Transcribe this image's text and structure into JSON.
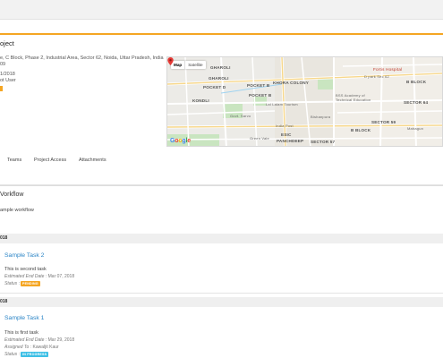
{
  "project": {
    "title": "oject",
    "address": "e, C Block, Phase 2, Industrial Area, Sector 62, Noida, Uttar Pradesh, India",
    "zip": "09",
    "date": "1/2018",
    "user": "ot User",
    "status_color": "#f5a623"
  },
  "map": {
    "type_map": "Map",
    "type_satellite": "Satellite",
    "logo": "Google",
    "labels": {
      "gharoli": "GHAROLI",
      "gharoli2": "GHAROLI",
      "pocket_d": "POCKET D",
      "pocket_b": "POCKET B",
      "khora": "KHORA COLONY",
      "kondli": "KONDLI",
      "pocket_b2": "POCKET B",
      "b_block": "B BLOCK",
      "b_block2": "B BLOCK",
      "bishanpura": "Bishanpura",
      "sector59": "SECTOR 59",
      "sector64": "SECTOR 64",
      "sector57": "SECTOR 57",
      "esic": "ESIC",
      "panchdeep": "PANCHDEEP",
      "govt_school": "Govt. Sarvo",
      "fortis": "Fortis Hospital",
      "d_park": "D park Sec 62",
      "academy": "BSS Academy of",
      "technical": "Technical Education",
      "lal_tourism": "Lal Lalam Tourism",
      "mahagun": "Mahagun",
      "india_post": "India Post",
      "green_valley": "Green Vale"
    }
  },
  "tabs": [
    "Teams",
    "Project Access",
    "Attachments"
  ],
  "workflow": {
    "title": "Vorkflow",
    "description": "ample workflow"
  },
  "tasks": [
    {
      "date_header": "018",
      "title": "Sample Task 2",
      "description": "This is second task",
      "end_label": "Estimated End Date",
      "end_date": "Mar 07, 2018",
      "status_label": "Status",
      "status_badge": "PENDING",
      "badge_color": "#f5a623"
    },
    {
      "date_header": "018",
      "title": "Sample Task 1",
      "description": "This is first task",
      "end_label": "Estimated End Date",
      "end_date": "Mar 29, 2018",
      "assigned_label": "Assigned To",
      "assigned_to": "Kawaljit Kaur",
      "status_label": "Status",
      "status_badge": "IN PROGRESS",
      "badge_color": "#3ec0e6"
    }
  ]
}
